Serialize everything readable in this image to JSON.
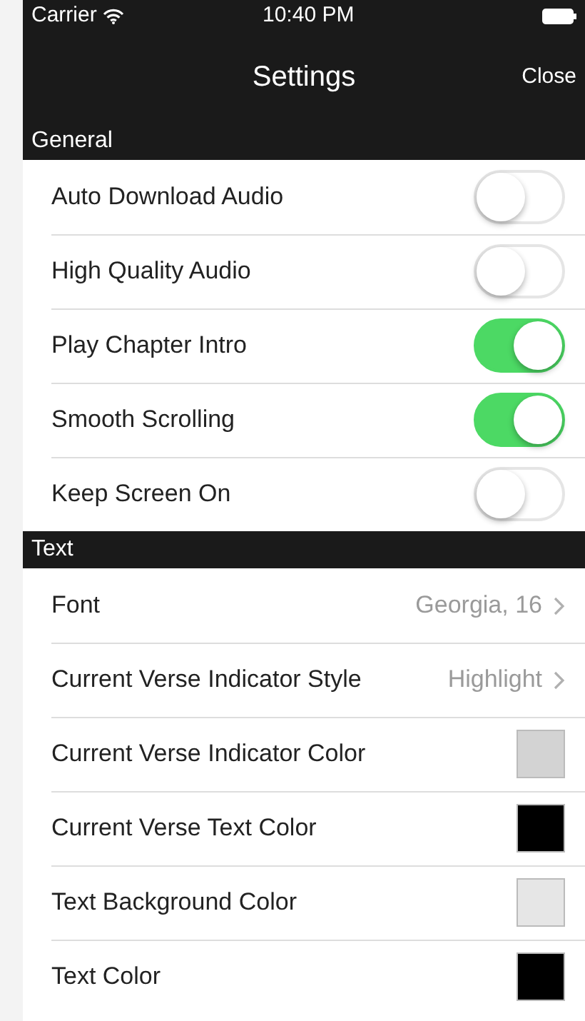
{
  "status_bar": {
    "carrier": "Carrier",
    "time": "10:40 PM"
  },
  "nav_bar": {
    "title": "Settings",
    "close": "Close"
  },
  "sections": [
    {
      "title": "General",
      "rows": [
        {
          "kind": "toggle",
          "label": "Auto Download Audio",
          "on": false
        },
        {
          "kind": "toggle",
          "label": "High Quality Audio",
          "on": false
        },
        {
          "kind": "toggle",
          "label": "Play Chapter Intro",
          "on": true
        },
        {
          "kind": "toggle",
          "label": "Smooth Scrolling",
          "on": true
        },
        {
          "kind": "toggle",
          "label": "Keep Screen On",
          "on": false
        }
      ]
    },
    {
      "title": "Text",
      "rows": [
        {
          "kind": "disclosure",
          "label": "Font",
          "value": "Georgia, 16"
        },
        {
          "kind": "disclosure",
          "label": "Current Verse Indicator Style",
          "value": "Highlight"
        },
        {
          "kind": "color",
          "label": "Current Verse Indicator Color",
          "color": "#d3d3d3"
        },
        {
          "kind": "color",
          "label": "Current Verse Text Color",
          "color": "#000000"
        },
        {
          "kind": "color",
          "label": "Text Background Color",
          "color": "#e6e6e6"
        },
        {
          "kind": "color",
          "label": "Text Color",
          "color": "#000000"
        }
      ]
    }
  ]
}
